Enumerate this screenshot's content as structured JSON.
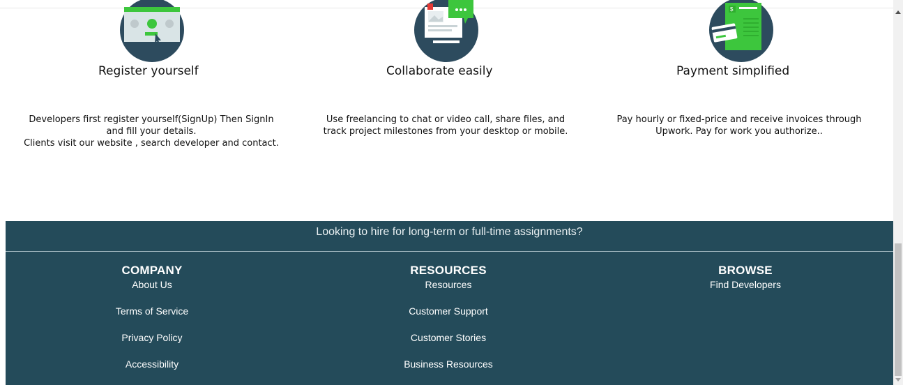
{
  "features": [
    {
      "icon": "register-icon",
      "title": "Register yourself",
      "description_lines": [
        "Developers first register yourself(SignUp) Then SignIn",
        "and fill your details.",
        "Clients visit our website , search developer and contact."
      ]
    },
    {
      "icon": "collaborate-icon",
      "title": "Collaborate easily",
      "description_lines": [
        "Use freelancing to chat or video call, share files, and",
        "track project milestones from your desktop or mobile."
      ]
    },
    {
      "icon": "invoice-icon",
      "title": "Payment simplified",
      "description_lines": [
        "Pay hourly or fixed-price and receive invoices through",
        "Upwork. Pay for work you authorize.."
      ]
    }
  ],
  "footer": {
    "banner": "Looking to hire for long-term or full-time assignments?",
    "columns": [
      {
        "heading": "COMPANY",
        "links": [
          "About Us",
          "Terms of Service",
          "Privacy Policy",
          "Accessibility"
        ]
      },
      {
        "heading": "RESOURCES",
        "links": [
          "Resources",
          "Customer Support",
          "Customer Stories",
          "Business Resources"
        ]
      },
      {
        "heading": "BROWSE",
        "links": [
          "Find Developers"
        ]
      }
    ]
  },
  "colors": {
    "footer_bg": "#244b5a",
    "icon_circle": "#2d4b5e",
    "icon_green": "#3dc63d"
  }
}
